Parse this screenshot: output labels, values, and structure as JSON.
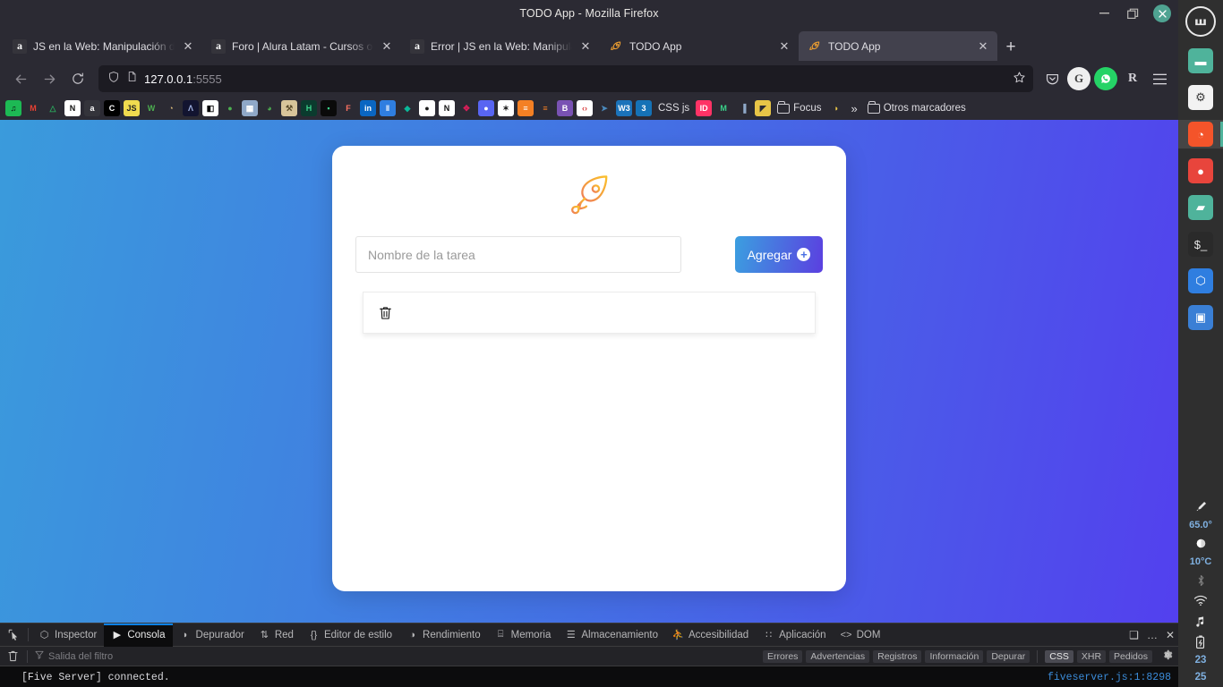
{
  "window": {
    "title": "TODO App - Mozilla Firefox",
    "minimize_label": "–",
    "maximize_label": "❐",
    "close_label": "✕"
  },
  "tabs": [
    {
      "favicon": "amazon-icon",
      "label": "JS en la Web: Manipulación del",
      "close_label": "✕",
      "active": false
    },
    {
      "favicon": "amazon-icon",
      "label": "Foro | Alura Latam - Cursos onli",
      "close_label": "✕",
      "active": false
    },
    {
      "favicon": "amazon-icon",
      "label": "Error | JS en la Web: Manipulaci",
      "close_label": "✕",
      "active": false
    },
    {
      "favicon": "rocket-icon",
      "label": "TODO App",
      "close_label": "✕",
      "active": false
    },
    {
      "favicon": "rocket-icon",
      "label": "TODO App",
      "close_label": "✕",
      "active": true
    }
  ],
  "new_tab_label": "+",
  "nav": {
    "back_label": "←",
    "forward_label": "→",
    "reload_label": "⟳",
    "url": "127.0.0.1",
    "url_port": ":5555",
    "bookmark_star_label": "☆",
    "shield_label": "⛉",
    "page_label": "□",
    "pocket_label": "⬇",
    "extension_g_label": "G",
    "extension_whatsapp_label": "✆",
    "extension_r_label": "R",
    "menu_label": "☰"
  },
  "bookmarks": {
    "items": [
      {
        "name": "spotify-icon",
        "glyph": "♫",
        "bg": "#1db954",
        "fg": "#0a0a0a"
      },
      {
        "name": "gmail-icon",
        "glyph": "M",
        "bg": "#2b2a33",
        "fg": "#e74133"
      },
      {
        "name": "google-drive-icon",
        "glyph": "△",
        "bg": "#2b2a33",
        "fg": "#2aa35a"
      },
      {
        "name": "notion-icon",
        "glyph": "N",
        "bg": "#ffffff",
        "fg": "#111111"
      },
      {
        "name": "amazon-icon",
        "glyph": "a",
        "bg": "#34343b",
        "fg": "#ffffff"
      },
      {
        "name": "codepen-icon",
        "glyph": "C",
        "bg": "#000000",
        "fg": "#ffffff"
      },
      {
        "name": "javascript-icon",
        "glyph": "JS",
        "bg": "#f0db4f",
        "fg": "#222222"
      },
      {
        "name": "w3-icon",
        "glyph": "W",
        "bg": "#2b2a33",
        "fg": "#4caf50"
      },
      {
        "name": "gandalf-icon",
        "glyph": "◔",
        "bg": "#2b2a33",
        "fg": "#d8b97a"
      },
      {
        "name": "lambda-icon",
        "glyph": "Λ",
        "bg": "#121430",
        "fg": "#9fb0e0"
      },
      {
        "name": "contrast-icon",
        "glyph": "◧",
        "bg": "#ffffff",
        "fg": "#000000"
      },
      {
        "name": "figma-alt-icon",
        "glyph": "●",
        "bg": "#2b2a33",
        "fg": "#4caf50"
      },
      {
        "name": "news-icon",
        "glyph": "▦",
        "bg": "#8fa8c8",
        "fg": "#ffffff"
      },
      {
        "name": "pink-icon",
        "glyph": "◕",
        "bg": "#2b2a33",
        "fg": "#4caf50"
      },
      {
        "name": "work-icon",
        "glyph": "⚒",
        "bg": "#d8c49a",
        "fg": "#5a4a2a"
      },
      {
        "name": "hostinger-icon",
        "glyph": "H",
        "bg": "#0b3b2e",
        "fg": "#3ad18a"
      },
      {
        "name": "green-icon",
        "glyph": "▪",
        "bg": "#0a0a0a",
        "fg": "#3ad18a"
      },
      {
        "name": "figma-icon",
        "glyph": "F",
        "bg": "#2b2a33",
        "fg": "#ff7262"
      },
      {
        "name": "linkedin-icon",
        "glyph": "in",
        "bg": "#0a66c2",
        "fg": "#ffffff"
      },
      {
        "name": "trello-icon",
        "glyph": "‖",
        "bg": "#2f7ee0",
        "fg": "#ffffff"
      },
      {
        "name": "diamond-icon",
        "glyph": "◆",
        "bg": "#2b2a33",
        "fg": "#0bb89a"
      },
      {
        "name": "github-icon",
        "glyph": "●",
        "bg": "#ffffff",
        "fg": "#1b1b1b"
      },
      {
        "name": "notion-alt-icon",
        "glyph": "N",
        "bg": "#ffffff",
        "fg": "#111111"
      },
      {
        "name": "slack-icon",
        "glyph": "✥",
        "bg": "#2b2a33",
        "fg": "#e01e5a"
      },
      {
        "name": "discord-icon",
        "glyph": "●",
        "bg": "#5865f2",
        "fg": "#ffffff"
      },
      {
        "name": "codewars-icon",
        "glyph": "✶",
        "bg": "#ffffff",
        "fg": "#1b1b1b"
      },
      {
        "name": "stackoverflow-icon",
        "glyph": "≡",
        "bg": "#f48024",
        "fg": "#ffffff"
      },
      {
        "name": "stackoverflow-alt-icon",
        "glyph": "≡",
        "bg": "#2b2a33",
        "fg": "#f48024"
      },
      {
        "name": "bootstrap-icon",
        "glyph": "B",
        "bg": "#7952b3",
        "fg": "#ffffff"
      },
      {
        "name": "codesandbox-icon",
        "glyph": "‹›",
        "bg": "#ffffff",
        "fg": "#d63a3a"
      },
      {
        "name": "python-icon",
        "glyph": "➤",
        "bg": "#2b2a33",
        "fg": "#4b8bbe"
      },
      {
        "name": "w3schools-icon",
        "glyph": "W3",
        "bg": "#1b73ba",
        "fg": "#ffffff"
      },
      {
        "name": "css3-icon",
        "glyph": "3",
        "bg": "#1572b6",
        "fg": "#ffffff"
      }
    ],
    "css_js_label": "CSS js",
    "extra": [
      {
        "name": "invision-icon",
        "glyph": "ID",
        "bg": "#ff3366",
        "fg": "#ffffff"
      },
      {
        "name": "mm-icon",
        "glyph": "M",
        "bg": "#2b2a33",
        "fg": "#3ad18a"
      },
      {
        "name": "bars-icon",
        "glyph": "▐",
        "bg": "#2b2a33",
        "fg": "#8fa8c8"
      },
      {
        "name": "yellow-icon",
        "glyph": "◤",
        "bg": "#e8c547",
        "fg": "#2b2a33"
      }
    ],
    "focus_folder_label": "Focus",
    "handshake_label": "🤝",
    "chevron_label": "»",
    "other_bookmarks_label": "Otros marcadores"
  },
  "page": {
    "rocket_icon": "rocket-icon",
    "input_placeholder": "Nombre de la tarea",
    "input_value": "",
    "add_button_label": "Agregar",
    "add_button_plus": "+",
    "tasks": [
      {
        "text": "",
        "delete_icon": "trash-icon"
      }
    ],
    "colors": {
      "bg_gradient_start": "#3a9bdc",
      "bg_gradient_end": "#5340ee",
      "button_gradient_start": "#3b9fe0",
      "button_gradient_end": "#5b3fe0",
      "card_bg": "#ffffff"
    }
  },
  "devtools": {
    "picker_label": "↖",
    "tabs": [
      {
        "label": "Inspector",
        "icon": "inspector-icon",
        "glyph": "⬡",
        "active": false
      },
      {
        "label": "Consola",
        "icon": "console-icon",
        "glyph": "▶",
        "active": true
      },
      {
        "label": "Depurador",
        "icon": "debugger-icon",
        "glyph": "◗",
        "active": false
      },
      {
        "label": "Red",
        "icon": "network-icon",
        "glyph": "⇅",
        "active": false
      },
      {
        "label": "Editor de estilo",
        "icon": "style-editor-icon",
        "glyph": "{}",
        "active": false
      },
      {
        "label": "Rendimiento",
        "icon": "performance-icon",
        "glyph": "◑",
        "active": false
      },
      {
        "label": "Memoria",
        "icon": "memory-icon",
        "glyph": "⌸",
        "active": false
      },
      {
        "label": "Almacenamiento",
        "icon": "storage-icon",
        "glyph": "☰",
        "active": false
      },
      {
        "label": "Accesibilidad",
        "icon": "accessibility-icon",
        "glyph": "⛹",
        "active": false
      },
      {
        "label": "Aplicación",
        "icon": "application-icon",
        "glyph": "∷",
        "active": false
      },
      {
        "label": "DOM",
        "icon": "dom-icon",
        "glyph": "<>",
        "active": false
      }
    ],
    "dock_label": "❑",
    "more_label": "…",
    "close_label": "✕",
    "clear_label": "🗑",
    "filter_placeholder": "Salida del filtro",
    "filter_icon": "funnel-icon",
    "pills": [
      {
        "label": "Errores",
        "on": false
      },
      {
        "label": "Advertencias",
        "on": false
      },
      {
        "label": "Registros",
        "on": false
      },
      {
        "label": "Información",
        "on": false
      },
      {
        "label": "Depurar",
        "on": false
      }
    ],
    "pills2": [
      {
        "label": "CSS",
        "on": true
      },
      {
        "label": "XHR",
        "on": false
      },
      {
        "label": "Pedidos",
        "on": false
      }
    ],
    "settings_label": "⚙",
    "console_message": "[Five Server] connected.",
    "console_source": "fiveserver.js:1:8298"
  },
  "dock": {
    "logo_label": "Ⓜ",
    "apps": [
      {
        "name": "files-icon",
        "glyph": "▬",
        "bg": "#4fb39b",
        "fg": "#ffffff",
        "active": false
      },
      {
        "name": "settings-icon",
        "glyph": "⚙",
        "bg": "#f2f2f2",
        "fg": "#3a3a3a",
        "active": false
      },
      {
        "name": "firefox-icon",
        "glyph": "◔",
        "bg": "#f4542a",
        "fg": "#ffffff",
        "active": true
      },
      {
        "name": "chrome-icon",
        "glyph": "●",
        "bg": "#e8453c",
        "fg": "#ffffff",
        "active": false
      },
      {
        "name": "folder-icon",
        "glyph": "▰",
        "bg": "#4fb39b",
        "fg": "#ffffff",
        "active": false
      },
      {
        "name": "terminal-icon",
        "glyph": "$_",
        "bg": "#2a2a2a",
        "fg": "#e8e8e8",
        "active": false
      },
      {
        "name": "vscode-icon",
        "glyph": "⬡",
        "bg": "#2f7ee0",
        "fg": "#ffffff",
        "active": false
      },
      {
        "name": "screenshot-icon",
        "glyph": "▣",
        "bg": "#3a7fd5",
        "fg": "#ffffff",
        "active": false
      }
    ],
    "tray": {
      "brightness_icon": "brightness-icon",
      "brightness_glyph": "☀",
      "brightness_value": "65.0°",
      "weather_icon": "moon-icon",
      "weather_glyph": "◑",
      "weather_value": "10°C",
      "bluetooth_icon": "bluetooth-icon",
      "bluetooth_glyph": "ᛦ",
      "wifi_icon": "wifi-icon",
      "wifi_glyph": "◔",
      "music_icon": "music-icon",
      "music_glyph": "♫",
      "battery_icon": "battery-icon",
      "battery_glyph": "▯",
      "clock_hour": "23",
      "clock_minute": "25"
    }
  }
}
